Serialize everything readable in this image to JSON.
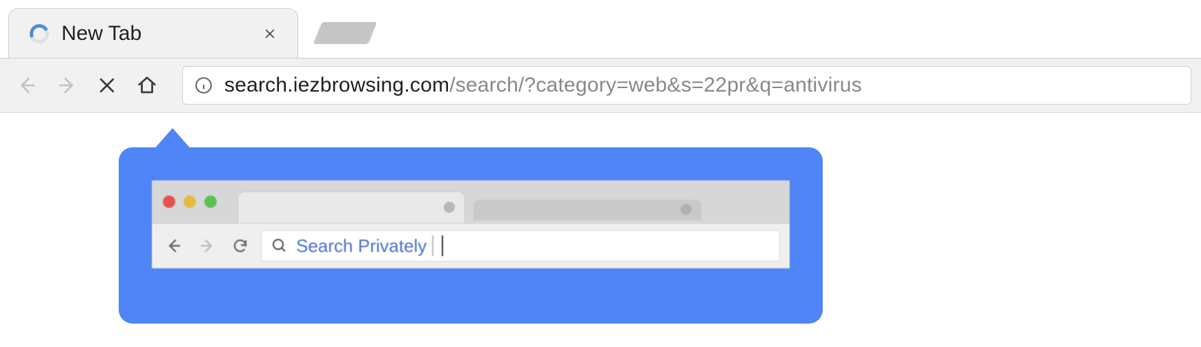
{
  "tab": {
    "title": "New Tab"
  },
  "addressbar": {
    "host": "search.iezbrowsing.com",
    "path": "/search/?category=web&s=22pr&q=antivirus"
  },
  "callout": {
    "searchPlaceholder": "Search Privately"
  }
}
